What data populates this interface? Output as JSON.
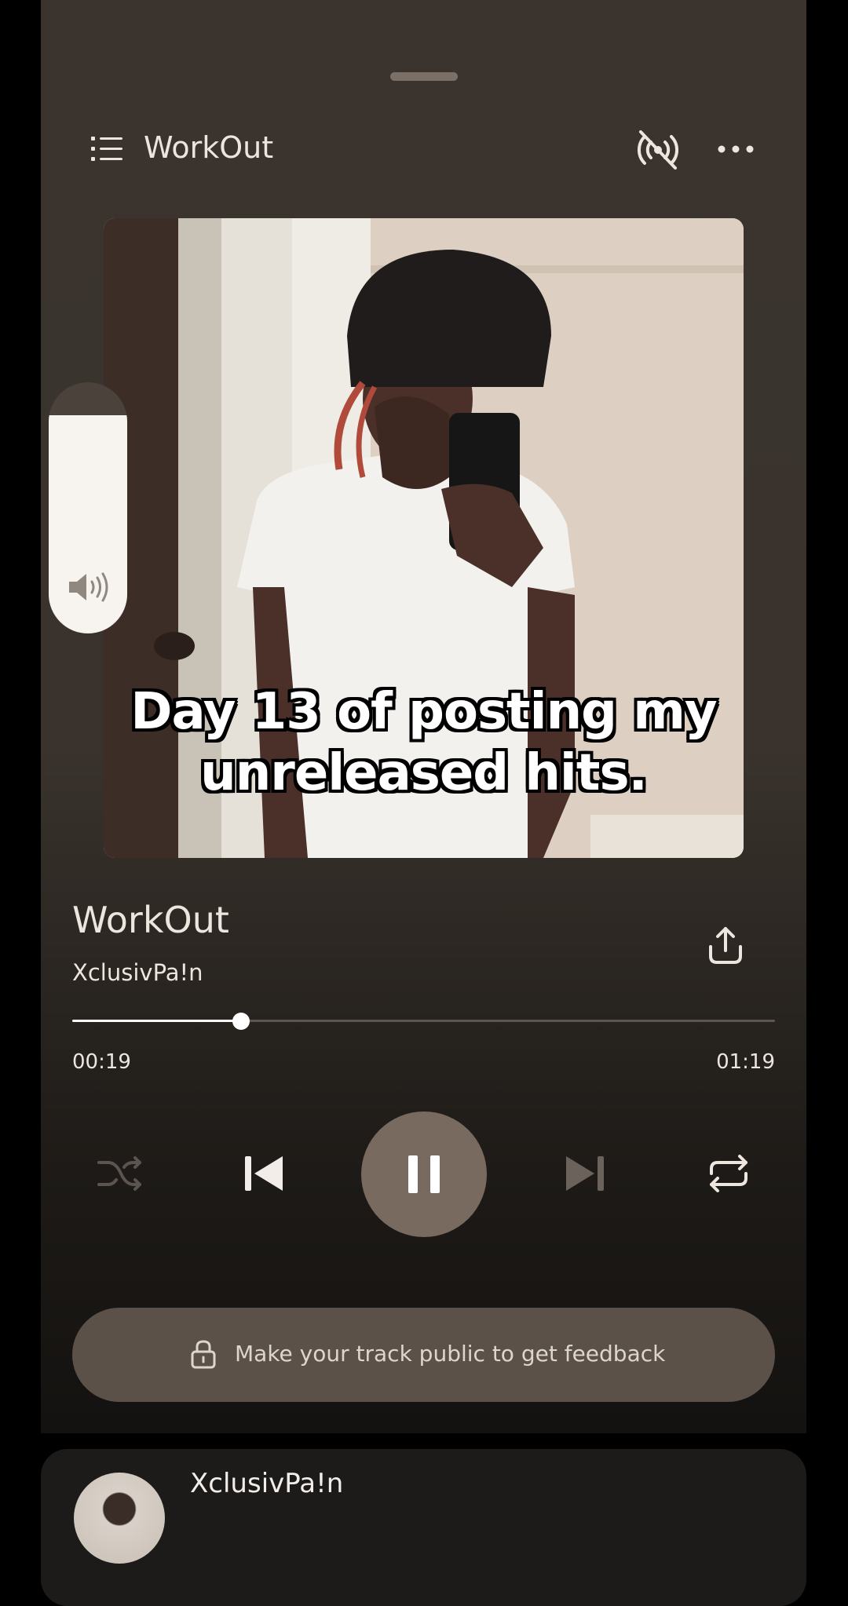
{
  "header": {
    "playlist_title": "WorkOut",
    "icons": [
      "list-icon",
      "cast-off-icon",
      "more-icon"
    ]
  },
  "artwork": {
    "caption_line1": "Day 13 of posting my",
    "caption_line2": "unreleased hits."
  },
  "volume": {
    "level": 0.87,
    "icon": "speaker-icon"
  },
  "track": {
    "title": "WorkOut",
    "artist": "XclusivPa!n",
    "elapsed": "00:19",
    "duration": "01:19",
    "progress": 0.24
  },
  "controls": {
    "icons": [
      "shuffle-icon",
      "previous-icon",
      "pause-icon",
      "next-icon",
      "repeat-icon"
    ]
  },
  "feedback": {
    "label": "Make your track public to get feedback"
  },
  "comments": {
    "author": "XclusivPa!n"
  },
  "colors": {
    "background": "#3b342e",
    "play_button": "#786a5f",
    "feedback_pill": "#5c5149"
  }
}
